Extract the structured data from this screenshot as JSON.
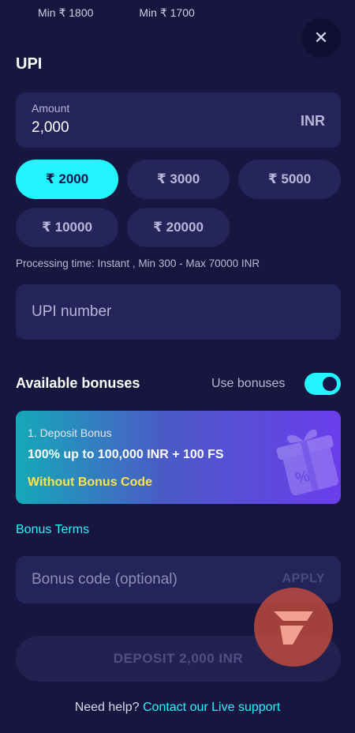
{
  "top_mins": [
    "Min ₹ 1800",
    "Min ₹ 1700"
  ],
  "close_symbol": "✕",
  "section_title": "UPI",
  "amount": {
    "label": "Amount",
    "value": "2,000",
    "currency": "INR"
  },
  "chips": [
    {
      "label": "₹ 2000",
      "active": true
    },
    {
      "label": "₹ 3000",
      "active": false
    },
    {
      "label": "₹ 5000",
      "active": false
    },
    {
      "label": "₹ 10000",
      "active": false
    },
    {
      "label": "₹ 20000",
      "active": false
    }
  ],
  "processing": "Processing time: Instant , Min 300 - Max 70000 INR",
  "upi_input": {
    "placeholder": "UPI number",
    "value": ""
  },
  "bonuses": {
    "title": "Available bonuses",
    "toggle_label": "Use bonuses",
    "toggle_on": true,
    "card": {
      "subtitle": "1. Deposit Bonus",
      "main": "100% up to 100,000 INR + 100 FS",
      "code_note": "Without Bonus Code"
    },
    "terms_link": "Bonus Terms"
  },
  "bonus_code": {
    "placeholder": "Bonus code (optional)",
    "apply_label": "APPLY"
  },
  "deposit_label": "DEPOSIT 2,000 INR",
  "help": {
    "text": "Need help?",
    "link": "Contact our Live support"
  },
  "colors": {
    "background": "#17163f",
    "accent": "#22f5ff",
    "field": "#24235a",
    "bonus_code": "#ffe24a"
  },
  "icons": [
    "close-icon",
    "gift-icon",
    "logo-icon"
  ]
}
